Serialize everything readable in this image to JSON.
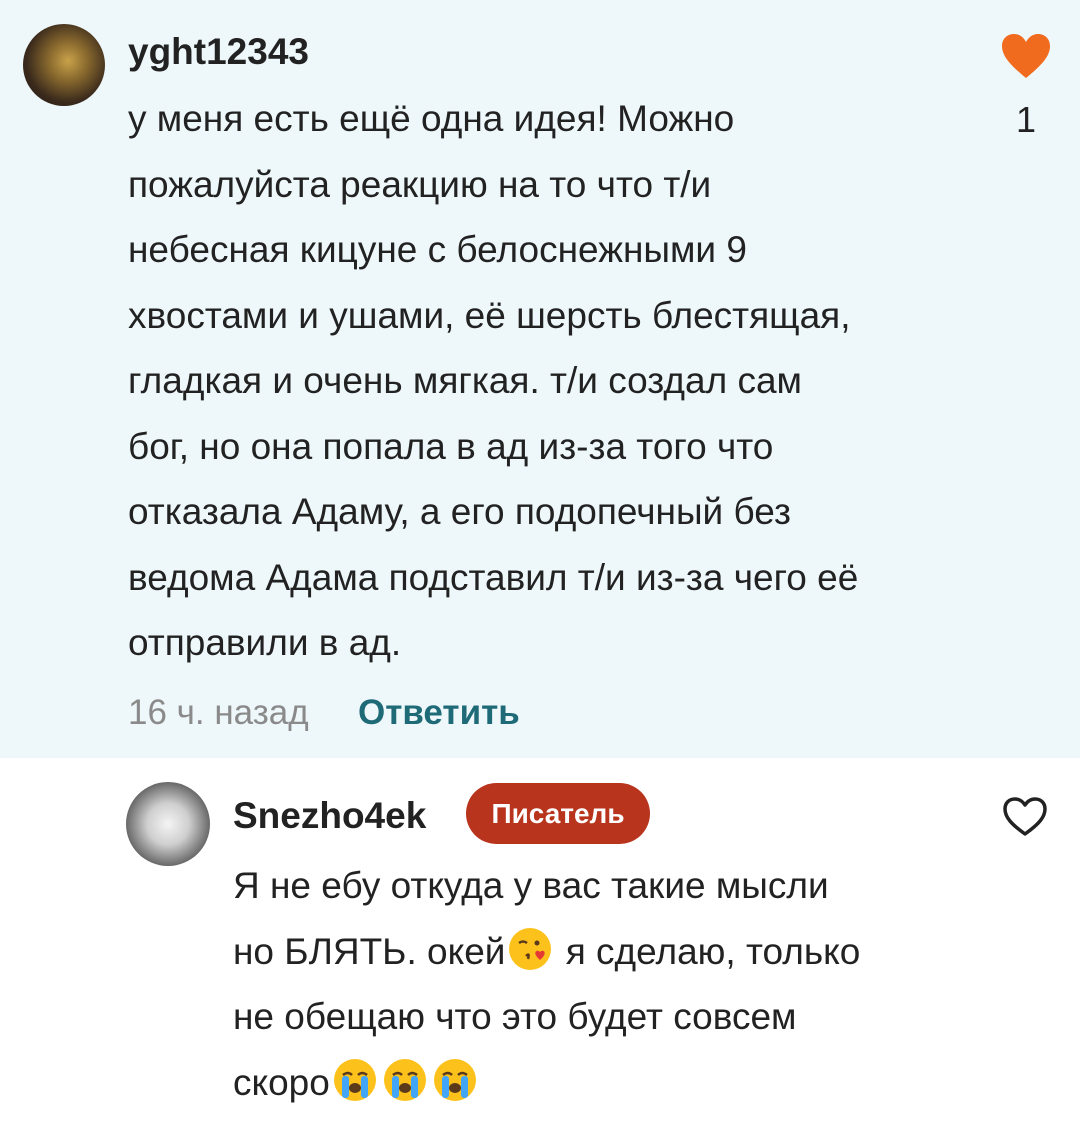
{
  "comment": {
    "username": "yght12343",
    "text_lines": [
      "у меня есть ещё одна идея! Можно",
      "пожалуйста реакцию на то что т/и",
      "небесная кицуне с белоснежными 9",
      "хвостами и ушами, её шерсть блестящая,",
      "гладкая и очень мягкая. т/и создал сам",
      "бог, но она попала в ад из-за того что",
      "отказала Адаму, а его подопечный без",
      "ведома Адама подставил т/и из-за чего её",
      "отправили в ад."
    ],
    "time": "16 ч. назад",
    "reply_label": "Ответить",
    "like_count": "1",
    "liked": true
  },
  "reply": {
    "username": "Snezho4ek",
    "badge": "Писатель",
    "line1": "Я не ебу откуда у вас такие мысли",
    "line2_a": "но БЛЯТЬ. окей",
    "line2_b": " я сделаю, только",
    "line3": "не обещаю что это будет совсем",
    "line4": "скоро",
    "emojis": [
      "face-blowing-kiss-emoji",
      "loudly-crying-face-emoji",
      "loudly-crying-face-emoji",
      "loudly-crying-face-emoji"
    ],
    "liked": false
  },
  "colors": {
    "highlight_bg": "#eef8fb",
    "heart": "#f06b1e",
    "reply_link": "#1f6a77",
    "badge_bg": "#b8341c"
  }
}
